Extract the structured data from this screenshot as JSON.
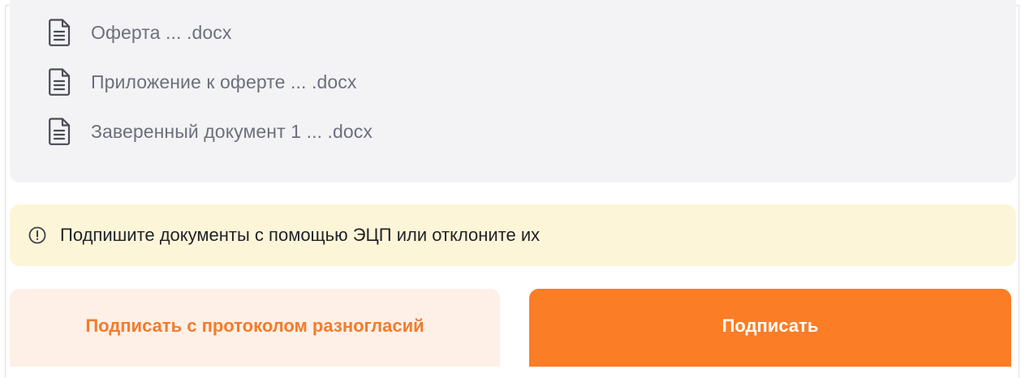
{
  "files": [
    {
      "name": "Оферта ... .docx",
      "icon": "document-icon"
    },
    {
      "name": "Приложение к оферте ... .docx",
      "icon": "document-icon"
    },
    {
      "name": "Заверенный документ 1 ... .docx",
      "icon": "document-icon"
    }
  ],
  "notice": {
    "icon": "info-circle-icon",
    "text": "Подпишите документы с помощью ЭЦП или отклоните их"
  },
  "actions": {
    "sign_with_protocol_label": "Подписать с протоколом разногласий",
    "sign_label": "Подписать"
  },
  "colors": {
    "accent": "#fb7d26",
    "accent_soft": "#fef0e7",
    "notice_bg": "#fdf5d8",
    "panel_bg": "#f3f3f5"
  }
}
